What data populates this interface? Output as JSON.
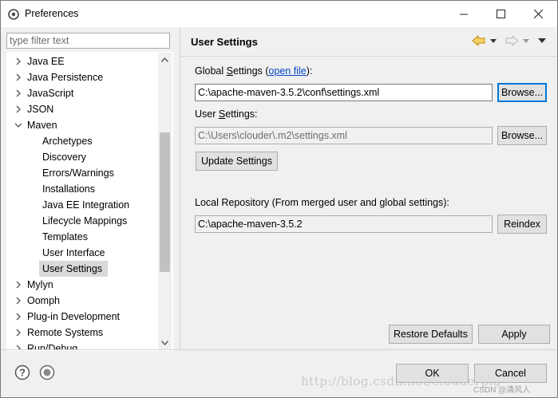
{
  "window": {
    "title": "Preferences"
  },
  "filter": {
    "placeholder": "type filter text"
  },
  "tree": {
    "items": [
      {
        "label": "Java EE",
        "level": 0,
        "expander": "collapsed"
      },
      {
        "label": "Java Persistence",
        "level": 0,
        "expander": "collapsed"
      },
      {
        "label": "JavaScript",
        "level": 0,
        "expander": "collapsed"
      },
      {
        "label": "JSON",
        "level": 0,
        "expander": "collapsed"
      },
      {
        "label": "Maven",
        "level": 0,
        "expander": "expanded"
      },
      {
        "label": "Archetypes",
        "level": 1
      },
      {
        "label": "Discovery",
        "level": 1
      },
      {
        "label": "Errors/Warnings",
        "level": 1
      },
      {
        "label": "Installations",
        "level": 1
      },
      {
        "label": "Java EE Integration",
        "level": 1
      },
      {
        "label": "Lifecycle Mappings",
        "level": 1
      },
      {
        "label": "Templates",
        "level": 1
      },
      {
        "label": "User Interface",
        "level": 1
      },
      {
        "label": "User Settings",
        "level": 1,
        "selected": true
      },
      {
        "label": "Mylyn",
        "level": 0,
        "expander": "collapsed"
      },
      {
        "label": "Oomph",
        "level": 0,
        "expander": "collapsed"
      },
      {
        "label": "Plug-in Development",
        "level": 0,
        "expander": "collapsed"
      },
      {
        "label": "Remote Systems",
        "level": 0,
        "expander": "collapsed"
      },
      {
        "label": "Run/Debug",
        "level": 0,
        "expander": "collapsed"
      }
    ]
  },
  "page": {
    "title": "User Settings",
    "global_settings": {
      "label_prefix": "Global ",
      "label_mnemonic": "S",
      "label_rest": "ettings (",
      "link": "open file",
      "label_suffix": "):",
      "value": "C:\\apache-maven-3.5.2\\conf\\settings.xml",
      "browse": "Browse..."
    },
    "user_settings": {
      "label_prefix": "User ",
      "label_mnemonic": "S",
      "label_rest": "ettings:",
      "value": "C:\\Users\\clouder\\.m2\\settings.xml",
      "browse": "Browse..."
    },
    "update_button": "Update Settings",
    "local_repo": {
      "label": "Local Repository (From merged user and global settings):",
      "value": "C:\\apache-maven-3.5.2",
      "reindex": "Reindex"
    },
    "restore_defaults": "Restore Defaults",
    "apply": "Apply"
  },
  "footer": {
    "ok": "OK",
    "cancel": "Cancel",
    "watermark": "http://blog.csdn.net/clouderpig",
    "csdn_tag": "CSDN @清风人"
  },
  "colors": {
    "accent": "#0078d7",
    "link": "#0645c7",
    "back_arrow": "#e8a400",
    "selection": "#d9d9d9"
  }
}
